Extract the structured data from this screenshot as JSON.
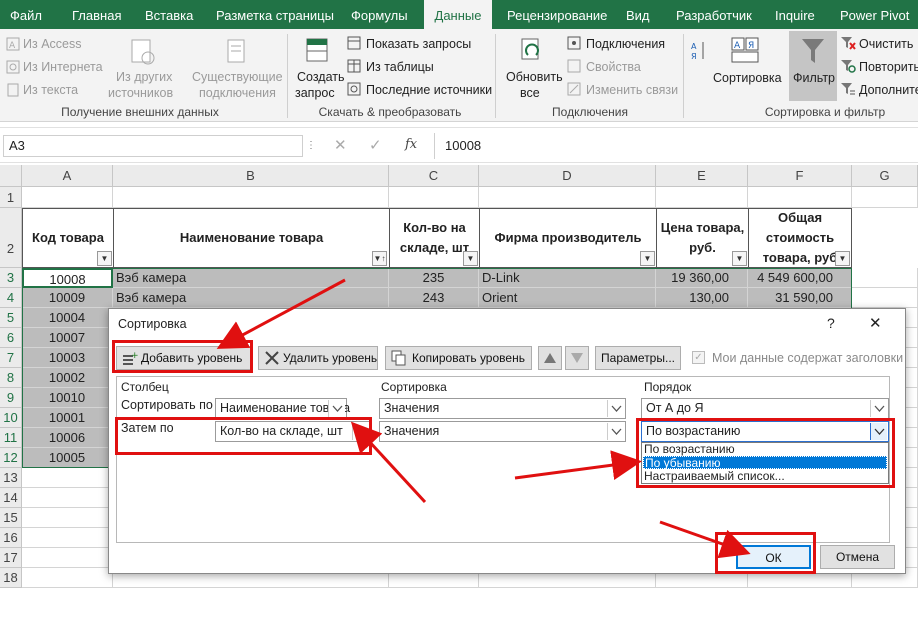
{
  "tabs": [
    "Файл",
    "Главная",
    "Вставка",
    "Разметка страницы",
    "Формулы",
    "Данные",
    "Рецензирование",
    "Вид",
    "Разработчик",
    "Inquire",
    "Power Pivot"
  ],
  "ribbon": {
    "g1": {
      "access": "Из Access",
      "internet": "Из Интернета",
      "text": "Из текста",
      "other1": "Из других",
      "other2": "источников",
      "exist1": "Существующие",
      "exist2": "подключения",
      "label": "Получение внешних данных"
    },
    "g2": {
      "create1": "Создать",
      "create2": "запрос",
      "show": "Показать запросы",
      "table": "Из таблицы",
      "recent": "Последние источники",
      "label": "Скачать & преобразовать"
    },
    "g3": {
      "refresh1": "Обновить",
      "refresh2": "все",
      "conn": "Подключения",
      "props": "Свойства",
      "links": "Изменить связи",
      "label": "Подключения"
    },
    "g4": {
      "sort": "Сортировка",
      "filter": "Фильтр",
      "clear": "Очистить",
      "reapply": "Повторить",
      "advanced": "Дополните",
      "label": "Сортировка и фильтр"
    }
  },
  "formula": {
    "namebox": "A3",
    "value": "10008",
    "fx": "fx"
  },
  "columns": [
    "A",
    "B",
    "C",
    "D",
    "E",
    "F",
    "G"
  ],
  "rows": [
    "1",
    "2",
    "3",
    "4",
    "5",
    "6",
    "7",
    "8",
    "9",
    "10",
    "11",
    "12",
    "13",
    "14",
    "15",
    "16",
    "17",
    "18"
  ],
  "headers": {
    "a": "Код товара",
    "b": "Наименование товара",
    "c": "Кол-во на складе, шт",
    "d": "Фирма производитель",
    "e": "Цена товара, руб.",
    "f": "Общая стоимость товара, руб"
  },
  "table_rows": [
    {
      "a": "10008",
      "b": "Вэб камера",
      "c": "235",
      "d": "D-Link",
      "e": "19 360,00",
      "f": "4 549 600,00"
    },
    {
      "a": "10009",
      "b": "Вэб камера",
      "c": "243",
      "d": "Orient",
      "e": "130,00",
      "f": "31 590,00"
    },
    {
      "a": "10004"
    },
    {
      "a": "10007"
    },
    {
      "a": "10003"
    },
    {
      "a": "10002"
    },
    {
      "a": "10010"
    },
    {
      "a": "10001"
    },
    {
      "a": "10006"
    },
    {
      "a": "10005"
    }
  ],
  "dialog": {
    "title": "Сортировка",
    "help": "?",
    "close": "✕",
    "add": "Добавить уровень",
    "delete": "Удалить уровень",
    "copy": "Копировать уровень",
    "params": "Параметры...",
    "has_headers": "Мои данные содержат заголовки",
    "col_hdr": "Столбец",
    "sort_hdr": "Сортировка",
    "order_hdr": "Порядок",
    "row1": {
      "label": "Сортировать по",
      "column": "Наименование товара",
      "sort": "Значения",
      "order": "От А до Я"
    },
    "row2": {
      "label": "Затем по",
      "column": "Кол-во на складе, шт",
      "sort": "Значения",
      "order": "По возрастанию"
    },
    "options": [
      "По возрастанию",
      "По убыванию",
      "Настраиваемый список..."
    ],
    "ok": "ОК",
    "cancel": "Отмена"
  },
  "colors": {
    "excel_green": "#217346",
    "annotation_red": "#e01010",
    "selection": "#bcbcbc"
  }
}
